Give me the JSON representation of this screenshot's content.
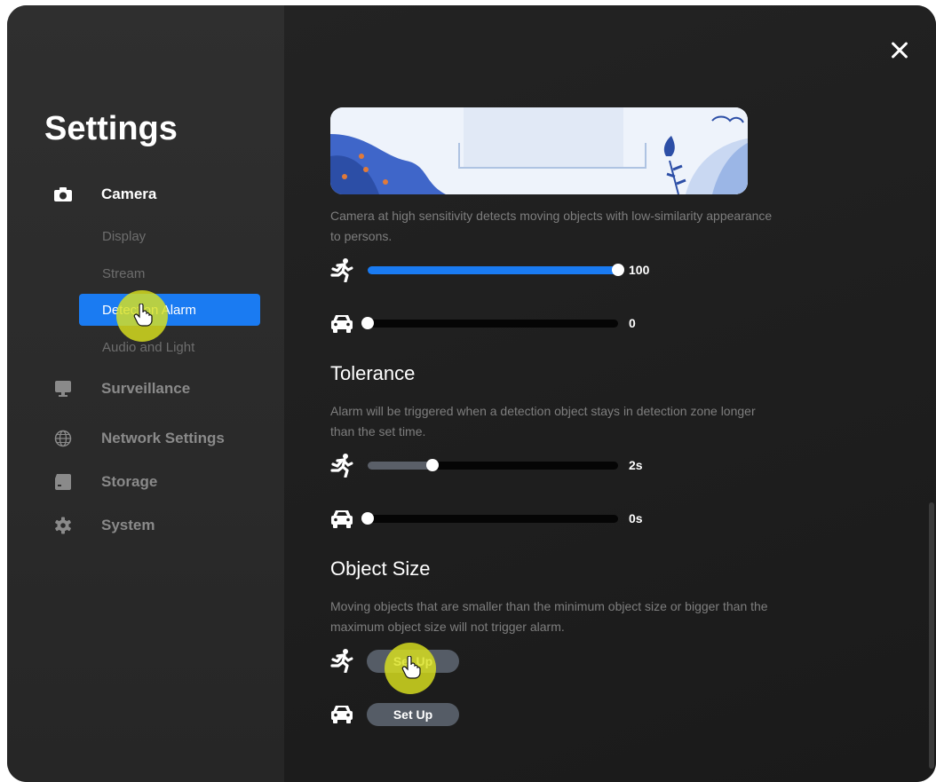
{
  "window": {
    "title": "Settings"
  },
  "sidebar": {
    "items": [
      {
        "label": "Camera",
        "icon": "camera-icon",
        "active": true,
        "sub_items": [
          {
            "label": "Display"
          },
          {
            "label": "Stream"
          },
          {
            "label": "Detection Alarm",
            "selected": true
          },
          {
            "label": "Audio and Light"
          }
        ]
      },
      {
        "label": "Surveillance",
        "icon": "monitor-icon"
      },
      {
        "label": "Network Settings",
        "icon": "globe-icon"
      },
      {
        "label": "Storage",
        "icon": "storage-icon"
      },
      {
        "label": "System",
        "icon": "gear-icon"
      }
    ]
  },
  "sensitivity": {
    "description": "Camera at high sensitivity detects moving objects with low-similarity appearance to persons.",
    "person": {
      "icon": "running-person-icon",
      "value": 100,
      "max": 100,
      "value_label": "100"
    },
    "vehicle": {
      "icon": "car-icon",
      "value": 0,
      "max": 100,
      "value_label": "0"
    }
  },
  "tolerance": {
    "title": "Tolerance",
    "description": "Alarm will be triggered when a detection object stays in detection zone longer than the set time.",
    "person": {
      "icon": "running-person-icon",
      "fraction": 0.26,
      "value_label": "2s"
    },
    "vehicle": {
      "icon": "car-icon",
      "fraction": 0.0,
      "value_label": "0s"
    }
  },
  "object_size": {
    "title": "Object Size",
    "description": "Moving objects that are smaller than the minimum object size or bigger than the maximum object size will not trigger alarm.",
    "person": {
      "icon": "running-person-icon",
      "button_label": "Set Up"
    },
    "vehicle": {
      "icon": "car-icon",
      "button_label": "Set Up"
    }
  },
  "colors": {
    "accent": "#1a7bf2",
    "slider_fill_active": "#1a7bf2",
    "slider_fill_muted": "#5a5f68",
    "cursor_highlight": "#dae21e"
  }
}
